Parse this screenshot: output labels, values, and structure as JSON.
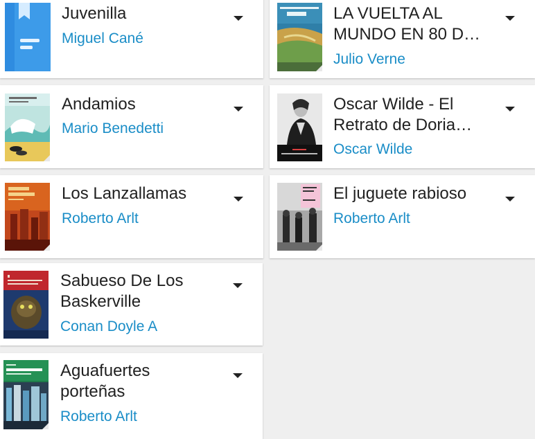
{
  "left_books": [
    {
      "title_lines": [
        "Juvenilla"
      ],
      "author": "Miguel Cané",
      "cover_icon": "book-bookmark-icon"
    },
    {
      "title_lines": [
        "Andamios"
      ],
      "author": "Mario Benedetti"
    },
    {
      "title_lines": [
        "Los Lanzallamas"
      ],
      "author": "Roberto Arlt"
    },
    {
      "title_lines": [
        "Sabueso De Los",
        "Baskerville"
      ],
      "author": "Conan Doyle A"
    },
    {
      "title_lines": [
        "Aguafuertes",
        "porteñas"
      ],
      "author": "Roberto Arlt"
    }
  ],
  "right_books": [
    {
      "title_lines": [
        "LA VUELTA AL",
        "MUNDO EN 80 D…"
      ],
      "author": "Julio Verne"
    },
    {
      "title_lines": [
        "Oscar Wilde - El",
        "Retrato de Doria…"
      ],
      "author": "Oscar Wilde"
    },
    {
      "title_lines": [
        "El juguete rabioso"
      ],
      "author": "Roberto Arlt"
    }
  ],
  "colors": {
    "author_link": "#1a8dc7",
    "title_text": "#212121",
    "background": "#efefef",
    "card": "#ffffff",
    "placeholder_cover": "#3d9be9"
  },
  "menu_icon": "dropdown-arrow-icon"
}
